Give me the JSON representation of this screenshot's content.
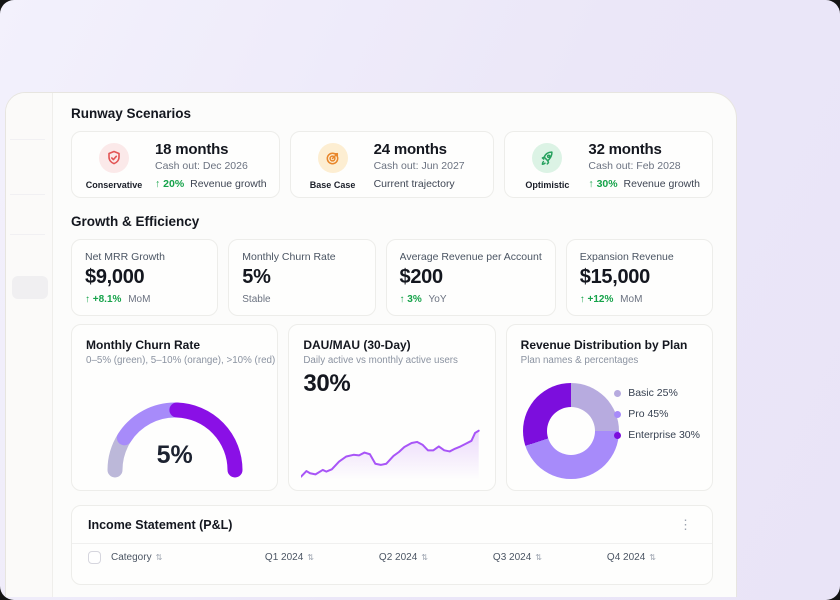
{
  "scenarios": {
    "heading": "Runway Scenarios",
    "cards": [
      {
        "icon": "shield-check-icon",
        "label": "Conservative",
        "months": "18 months",
        "cash_out": "Cash out: Dec 2026",
        "delta": "↑ 20%",
        "note": "Revenue growth",
        "icon_color": "#e25555",
        "icon_bg": "#fbe9e9"
      },
      {
        "icon": "target-icon",
        "label": "Base Case",
        "months": "24 months",
        "cash_out": "Cash out: Jun 2027",
        "delta": "",
        "note": "Current trajectory",
        "icon_color": "#e8872c",
        "icon_bg": "#fdeed2"
      },
      {
        "icon": "rocket-icon",
        "label": "Optimistic",
        "months": "32 months",
        "cash_out": "Cash out: Feb 2028",
        "delta": "↑ 30%",
        "note": "Revenue growth",
        "icon_color": "#27a15f",
        "icon_bg": "#dcf3e5"
      }
    ]
  },
  "growth": {
    "heading": "Growth & Efficiency",
    "metrics": [
      {
        "label": "Net MRR Growth",
        "value": "$9,000",
        "delta": "↑ +8.1%",
        "note": "MoM"
      },
      {
        "label": "Monthly Churn Rate",
        "value": "5%",
        "delta": "",
        "note": "Stable"
      },
      {
        "label": "Average Revenue per Account",
        "value": "$200",
        "delta": "↑ 3%",
        "note": "YoY"
      },
      {
        "label": "Expansion Revenue",
        "value": "$15,000",
        "delta": "↑ +12%",
        "note": "MoM"
      }
    ]
  },
  "colors": {
    "positive_green": "#16a34a",
    "accent_purple": "#a855f7"
  },
  "chart_data": [
    {
      "type": "gauge",
      "title": "Monthly Churn Rate",
      "subtitle": "0–5% (green), 5–10% (orange), >10% (red)",
      "value_label": "5%",
      "segments": [
        {
          "color": "#bcb8d9",
          "frac": 0.18
        },
        {
          "color": "#a78bfa",
          "frac": 0.33
        },
        {
          "color": "#8a10e6",
          "frac": 0.49
        }
      ]
    },
    {
      "type": "line",
      "title": "DAU/MAU (30-Day)",
      "subtitle": "Daily active vs monthly active users",
      "value_label": "30%",
      "line_color": "#a855f7",
      "x_range": [
        0,
        100
      ],
      "y_range": [
        0,
        100
      ],
      "points": [
        [
          0,
          6
        ],
        [
          3,
          16
        ],
        [
          5,
          12
        ],
        [
          8,
          10
        ],
        [
          12,
          18
        ],
        [
          14,
          15
        ],
        [
          17,
          19
        ],
        [
          21,
          33
        ],
        [
          25,
          42
        ],
        [
          29,
          45
        ],
        [
          32,
          44
        ],
        [
          35,
          49
        ],
        [
          38,
          46
        ],
        [
          41,
          29
        ],
        [
          44,
          27
        ],
        [
          47,
          29
        ],
        [
          51,
          43
        ],
        [
          54,
          50
        ],
        [
          57,
          59
        ],
        [
          61,
          66
        ],
        [
          64,
          68
        ],
        [
          67,
          63
        ],
        [
          70,
          53
        ],
        [
          73,
          53
        ],
        [
          76,
          60
        ],
        [
          79,
          53
        ],
        [
          82,
          51
        ],
        [
          85,
          56
        ],
        [
          88,
          60
        ],
        [
          91,
          65
        ],
        [
          94,
          70
        ],
        [
          96,
          84
        ],
        [
          98,
          88
        ]
      ]
    },
    {
      "type": "pie",
      "title": "Revenue Distribution by Plan",
      "subtitle": "Plan names & percentages",
      "donut": true,
      "legend_position": "right",
      "segments": [
        {
          "name": "Basic",
          "pct": 25,
          "color": "#b7abdf",
          "label": "Basic 25%"
        },
        {
          "name": "Pro",
          "pct": 45,
          "color": "#a78bfa",
          "label": "Pro 45%"
        },
        {
          "name": "Enterprise",
          "pct": 30,
          "color": "#7c0edd",
          "label": "Enterprise 30%"
        }
      ]
    }
  ],
  "table": {
    "title": "Income Statement (P&L)",
    "menu_icon": "⋮",
    "sort_icon": "⇅",
    "columns": [
      "Category",
      "Q1 2024",
      "Q2 2024",
      "Q3 2024",
      "Q4 2024"
    ]
  }
}
